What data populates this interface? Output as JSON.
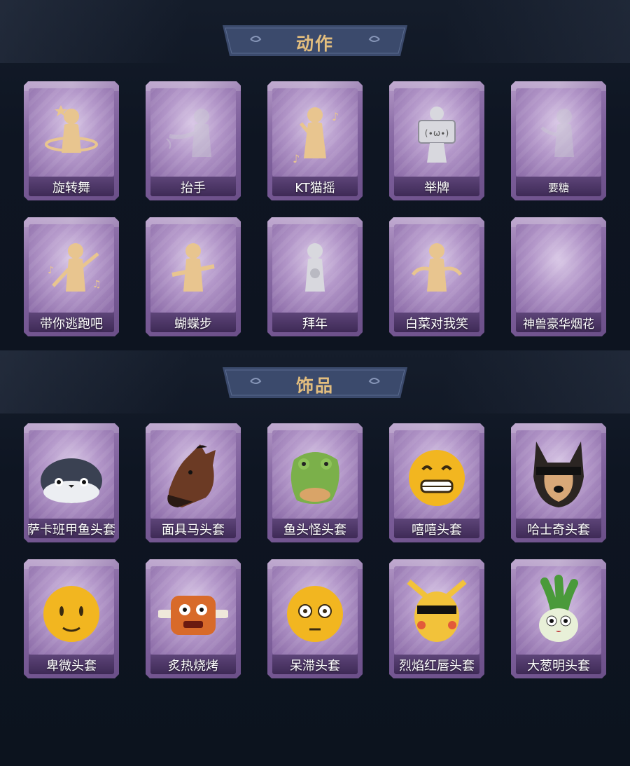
{
  "sections": {
    "actions": {
      "title": "动作",
      "items": [
        {
          "label": "旋转舞",
          "icon": "spin-dance-icon"
        },
        {
          "label": "抬手",
          "icon": "raise-hand-icon"
        },
        {
          "label": "KT猫摇",
          "icon": "kt-cat-shake-icon"
        },
        {
          "label": "举牌",
          "icon": "hold-sign-icon"
        },
        {
          "label": "要糖",
          "icon": "ask-candy-icon"
        },
        {
          "label": "带你逃跑吧",
          "icon": "run-away-icon"
        },
        {
          "label": "蝴蝶步",
          "icon": "butterfly-step-icon"
        },
        {
          "label": "拜年",
          "icon": "new-year-greeting-icon"
        },
        {
          "label": "白菜对我笑",
          "icon": "cabbage-smile-icon"
        },
        {
          "label": "神兽豪华烟花",
          "icon": "fireworks-icon"
        }
      ]
    },
    "accessories": {
      "title": "饰品",
      "items": [
        {
          "label": "萨卡班甲鱼头套",
          "icon": "sacabambaspis-head-icon"
        },
        {
          "label": "面具马头套",
          "icon": "horse-mask-icon"
        },
        {
          "label": "鱼头怪头套",
          "icon": "fish-head-icon"
        },
        {
          "label": "嘻嘻头套",
          "icon": "grin-emoji-head-icon"
        },
        {
          "label": "哈士奇头套",
          "icon": "husky-head-icon"
        },
        {
          "label": "卑微头套",
          "icon": "humble-emoji-head-icon"
        },
        {
          "label": "炙热烧烤",
          "icon": "bbq-meat-head-icon"
        },
        {
          "label": "呆滞头套",
          "icon": "dazed-emoji-head-icon"
        },
        {
          "label": "烈焰红唇头套",
          "icon": "pikachu-head-icon"
        },
        {
          "label": "大葱明头套",
          "icon": "scallion-head-icon"
        }
      ]
    }
  },
  "colors": {
    "background": "#0d1420",
    "banner_title": "#e3be7e",
    "card_frame": "#8d6fa8",
    "gold_icon": "#e8c58f",
    "grey_icon": "#c9c9d2"
  }
}
